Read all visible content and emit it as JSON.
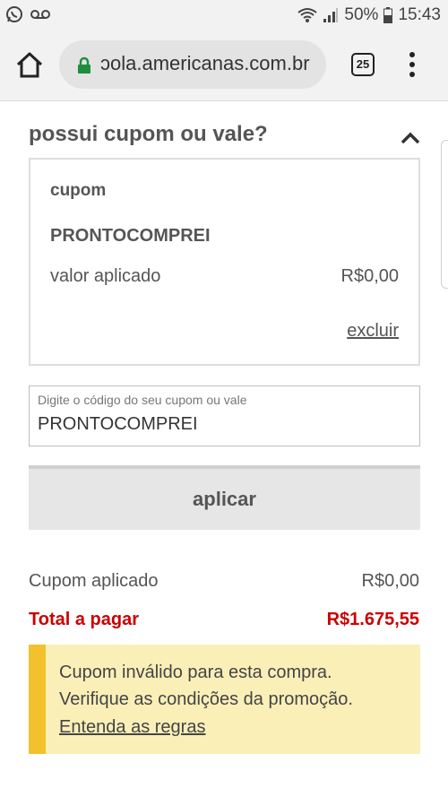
{
  "status_bar": {
    "battery": "50%",
    "time": "15:43",
    "icons": [
      "whatsapp-icon",
      "voicemail-icon",
      "wifi-icon",
      "signal-icon",
      "battery-icon"
    ]
  },
  "browser": {
    "url": "ɔola.americanas.com.br",
    "tab_count": "25",
    "icons": [
      "home-icon",
      "lock-icon",
      "tabs-icon",
      "overflow-menu-icon"
    ]
  },
  "coupon_section": {
    "title": "possui cupom ou vale?",
    "box": {
      "label": "cupom",
      "code": "PRONTOCOMPREI",
      "applied_label": "valor aplicado",
      "applied_value": "R$0,00",
      "remove_label": "excluir"
    },
    "input": {
      "label": "Digite o código do seu cupom ou vale",
      "value": "PRONTOCOMPREI"
    },
    "apply_label": "aplicar"
  },
  "summary": {
    "coupon_label": "Cupom aplicado",
    "coupon_value": "R$0,00",
    "total_label": "Total a pagar",
    "total_value": "R$1.675,55"
  },
  "alert": {
    "line1": "Cupom inválido para esta compra.",
    "line2": "Verifique as condições da promoção.",
    "link": "Entenda as regras"
  },
  "colors": {
    "total": "#cc0000",
    "alert_bg": "#fbefb8",
    "alert_accent": "#f2c12b",
    "lock": "#1e8e3e"
  }
}
